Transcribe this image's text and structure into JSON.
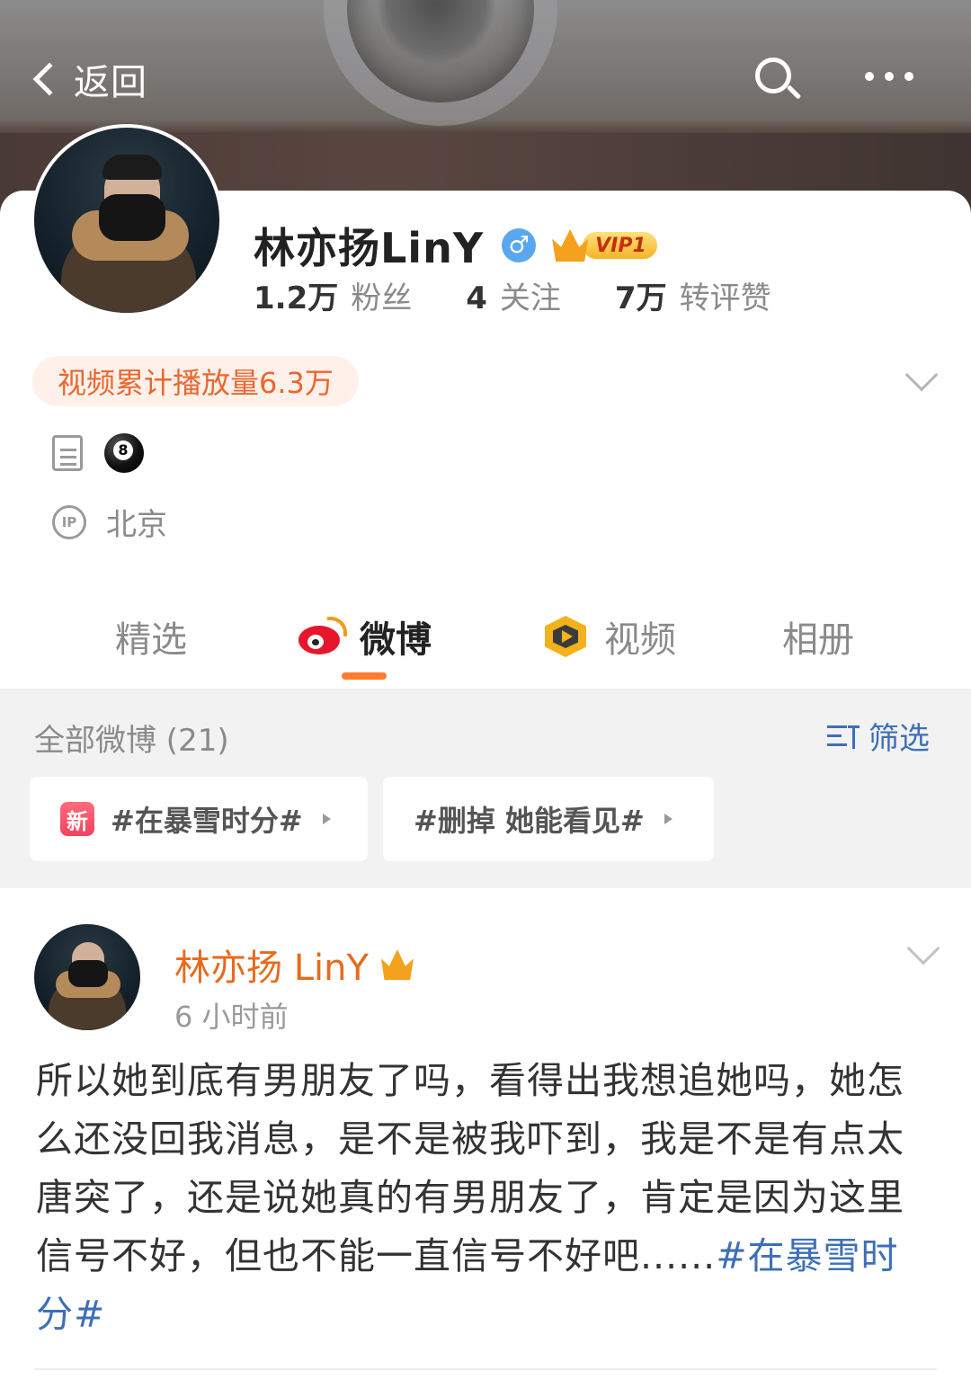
{
  "topbar": {
    "back_label": "返回"
  },
  "profile": {
    "name": "林亦扬LinY",
    "gender_symbol": "♂",
    "vip_label": "VIP1",
    "stats": [
      {
        "value": "1.2万",
        "label": "粉丝"
      },
      {
        "value": "4",
        "label": "关注"
      },
      {
        "value": "7万",
        "label": "转评赞"
      }
    ],
    "video_plays": "视频累计播放量6.3万",
    "ip_icon_text": "IP",
    "ip_location": "北京"
  },
  "tabs": [
    {
      "label": "精选"
    },
    {
      "label": "微博"
    },
    {
      "label": "视频"
    },
    {
      "label": "相册"
    }
  ],
  "feed_header": {
    "all_label": "全部微博 (21)",
    "filter_label": "筛选",
    "topics": [
      {
        "badge": "新",
        "label": "#在暴雪时分#"
      },
      {
        "label": "#删掉 她能看见#"
      }
    ]
  },
  "post": {
    "author": "林亦扬 LinY",
    "time": "6 小时前",
    "text": "所以她到底有男朋友了吗，看得出我想追她吗，她怎么还没回我消息，是不是被我吓到，我是不是有点太唐突了，还是说她真的有男朋友了，肯定是因为这里信号不好，但也不能一直信号不好吧......",
    "hashtag": "#在暴雪时分#"
  },
  "colors": {
    "accent_orange": "#ff7b2e",
    "link_blue": "#3d6fb8",
    "author_orange": "#e86a1c"
  }
}
